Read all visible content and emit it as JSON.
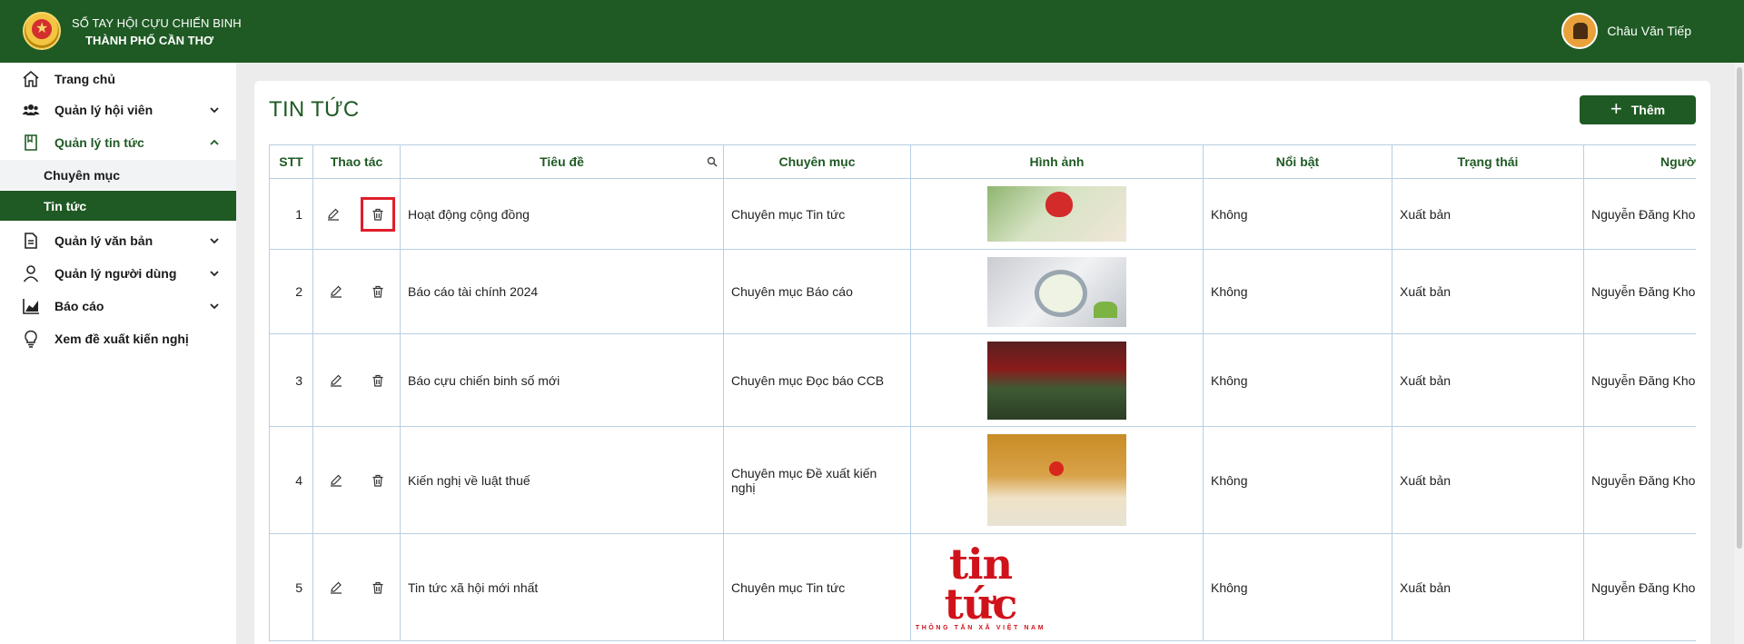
{
  "header": {
    "brand_line1": "SỔ TAY HỘI CỰU CHIẾN BINH",
    "brand_line2": "THÀNH PHỐ CẦN THƠ",
    "user_name": "Châu Văn Tiếp"
  },
  "sidebar": {
    "items": [
      {
        "label": "Trang chủ",
        "icon": "home-icon"
      },
      {
        "label": "Quản lý hội viên",
        "icon": "users-icon"
      },
      {
        "label": "Quản lý tin tức",
        "icon": "book-icon"
      },
      {
        "label": "Quản lý văn bản",
        "icon": "document-icon"
      },
      {
        "label": "Quản lý người dùng",
        "icon": "user-icon"
      },
      {
        "label": "Báo cáo",
        "icon": "chart-icon"
      },
      {
        "label": "Xem đề xuất kiến nghị",
        "icon": "lightbulb-icon"
      }
    ],
    "subitems": [
      {
        "label": "Chuyên mục"
      },
      {
        "label": "Tin tức"
      }
    ]
  },
  "main": {
    "title": "TIN TỨC",
    "add_label": "Thêm",
    "columns": [
      "STT",
      "Thao tác",
      "Tiêu đề",
      "Chuyên mục",
      "Hình ảnh",
      "Nổi bật",
      "Trạng thái",
      "Người t"
    ],
    "rows": [
      {
        "stt": "1",
        "title": "Hoạt động cộng đồng",
        "category": "Chuyên mục Tin tức",
        "featured": "Không",
        "status": "Xuất bản",
        "author": "Nguyễn Đăng Khoa"
      },
      {
        "stt": "2",
        "title": "Báo cáo tài chính 2024",
        "category": "Chuyên mục Báo cáo",
        "featured": "Không",
        "status": "Xuất bản",
        "author": "Nguyễn Đăng Khoa"
      },
      {
        "stt": "3",
        "title": "Báo cựu chiến binh số mới",
        "category": "Chuyên mục Đọc báo CCB",
        "featured": "Không",
        "status": "Xuất bản",
        "author": "Nguyễn Đăng Khoa"
      },
      {
        "stt": "4",
        "title": "Kiến nghị về luật thuế",
        "category": "Chuyên mục Đề xuất kiến nghị",
        "featured": "Không",
        "status": "Xuất bản",
        "author": "Nguyễn Đăng Khoa"
      },
      {
        "stt": "5",
        "title": "Tin tức xã hội mới nhất",
        "category": "Chuyên mục Tin tức",
        "featured": "Không",
        "status": "Xuất bản",
        "author": "Nguyễn Đăng Khoa"
      }
    ],
    "thumb_tintuc_big": "tin tức",
    "thumb_tintuc_small": "THÔNG TẤN XÃ VIỆT NAM"
  },
  "colors": {
    "primary": "#1f5a24",
    "border": "#b7cfe3",
    "highlight": "#e01e2a"
  }
}
